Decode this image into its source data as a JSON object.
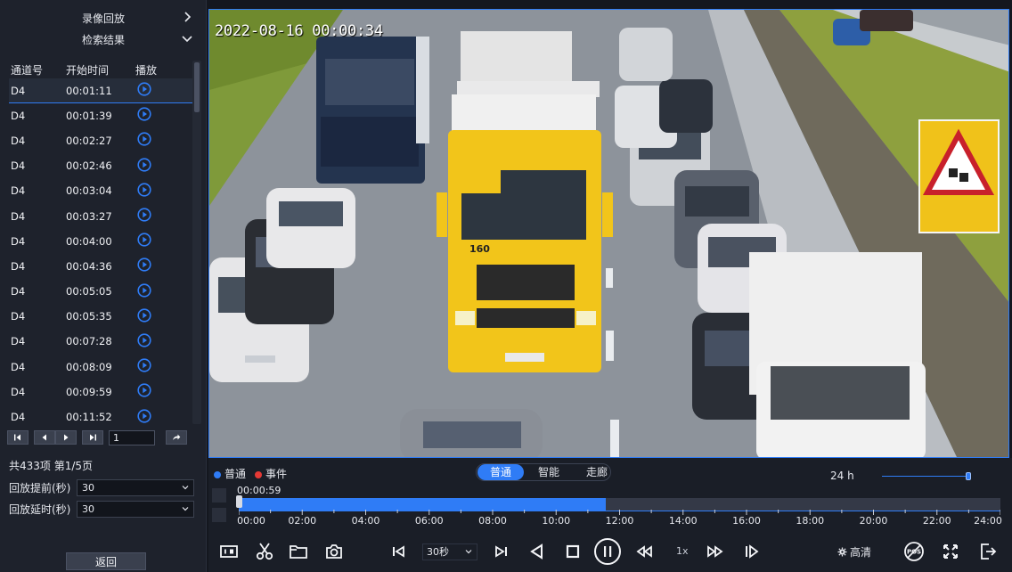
{
  "sidebar": {
    "title": "录像回放",
    "subtitle": "检索结果",
    "columns": [
      "通道号",
      "开始时间",
      "播放"
    ],
    "rows": [
      {
        "channel": "D4",
        "start": "00:01:11"
      },
      {
        "channel": "D4",
        "start": "00:01:39"
      },
      {
        "channel": "D4",
        "start": "00:02:27"
      },
      {
        "channel": "D4",
        "start": "00:02:46"
      },
      {
        "channel": "D4",
        "start": "00:03:04"
      },
      {
        "channel": "D4",
        "start": "00:03:27"
      },
      {
        "channel": "D4",
        "start": "00:04:00"
      },
      {
        "channel": "D4",
        "start": "00:04:36"
      },
      {
        "channel": "D4",
        "start": "00:05:05"
      },
      {
        "channel": "D4",
        "start": "00:05:35"
      },
      {
        "channel": "D4",
        "start": "00:07:28"
      },
      {
        "channel": "D4",
        "start": "00:08:09"
      },
      {
        "channel": "D4",
        "start": "00:09:59"
      },
      {
        "channel": "D4",
        "start": "00:11:52"
      }
    ],
    "page_input": "1",
    "summary": "共433项  第1/5页",
    "pre_label": "回放提前(秒)",
    "pre_value": "30",
    "post_label": "回放延时(秒)",
    "post_value": "30",
    "back_label": "返回"
  },
  "video": {
    "osd_timestamp": "2022-08-16 00:00:34",
    "truck_number": "160"
  },
  "timeline": {
    "legend_normal": "普通",
    "legend_event": "事件",
    "modes": [
      "普通",
      "智能",
      "走廊"
    ],
    "active_mode": 0,
    "span": "24 h",
    "cursor_time": "00:00:59",
    "recorded_fraction": 0.482,
    "zoom_level": 1.0,
    "hour_labels": [
      "00:00",
      "02:00",
      "04:00",
      "06:00",
      "08:00",
      "10:00",
      "12:00",
      "14:00",
      "16:00",
      "18:00",
      "20:00",
      "22:00",
      "24:00"
    ]
  },
  "controls": {
    "speed_step": "30秒",
    "rate": "1x",
    "quality": "高清"
  },
  "colors": {
    "accent": "#2f7cf6",
    "event": "#e53935",
    "panel": "#1e222c"
  },
  "icons": [
    "chevron-right-icon",
    "chevron-down-icon",
    "play-circle-icon",
    "first-page-icon",
    "prev-page-icon",
    "next-page-icon",
    "last-page-icon",
    "go-icon",
    "record-clip-icon",
    "scissors-icon",
    "folder-icon",
    "snapshot-icon",
    "skip-back-icon",
    "skip-forward-icon",
    "reverse-play-icon",
    "stop-icon",
    "pause-icon",
    "rewind-icon",
    "fast-forward-icon",
    "frame-step-icon",
    "settings-icon",
    "pos-off-icon",
    "fullscreen-icon",
    "exit-icon"
  ]
}
